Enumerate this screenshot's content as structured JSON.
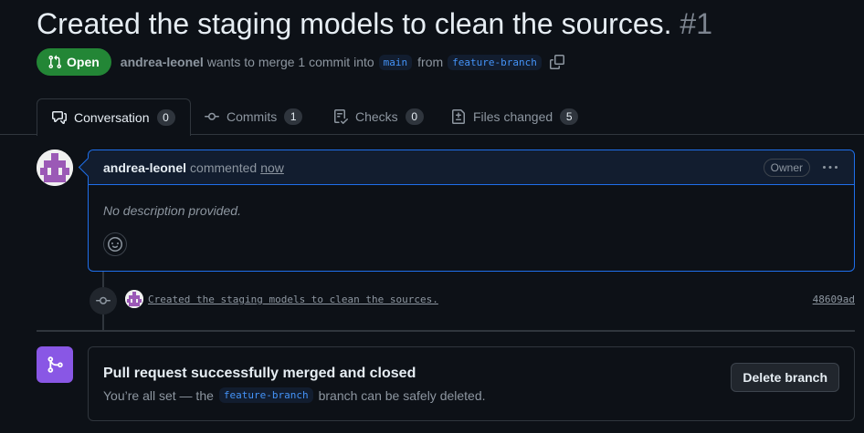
{
  "pr": {
    "title": "Created the staging models to clean the sources.",
    "number": "#1",
    "state": "Open",
    "author": "andrea-leonel",
    "merge_text": "wants to merge 1 commit into",
    "base_branch": "main",
    "from_text": "from",
    "head_branch": "feature-branch"
  },
  "tabs": [
    {
      "label": "Conversation",
      "count": "0",
      "icon": "comment-discussion-icon"
    },
    {
      "label": "Commits",
      "count": "1",
      "icon": "git-commit-icon"
    },
    {
      "label": "Checks",
      "count": "0",
      "icon": "checklist-icon"
    },
    {
      "label": "Files changed",
      "count": "5",
      "icon": "file-diff-icon"
    }
  ],
  "comment": {
    "author": "andrea-leonel",
    "action": "commented",
    "time": "now",
    "role": "Owner",
    "body": "No description provided."
  },
  "commit": {
    "message": "Created the staging models to clean the sources.",
    "sha": "48609ad"
  },
  "merge_status": {
    "title": "Pull request successfully merged and closed",
    "sub_prefix": "You’re all set — the",
    "branch": "feature-branch",
    "sub_suffix": "branch can be safely deleted.",
    "delete_label": "Delete branch"
  },
  "colors": {
    "open_badge": "#238636",
    "merged_purple": "#8957e5",
    "accent_blue": "#1f6feb",
    "avatar_purple": "#9b59b6"
  }
}
